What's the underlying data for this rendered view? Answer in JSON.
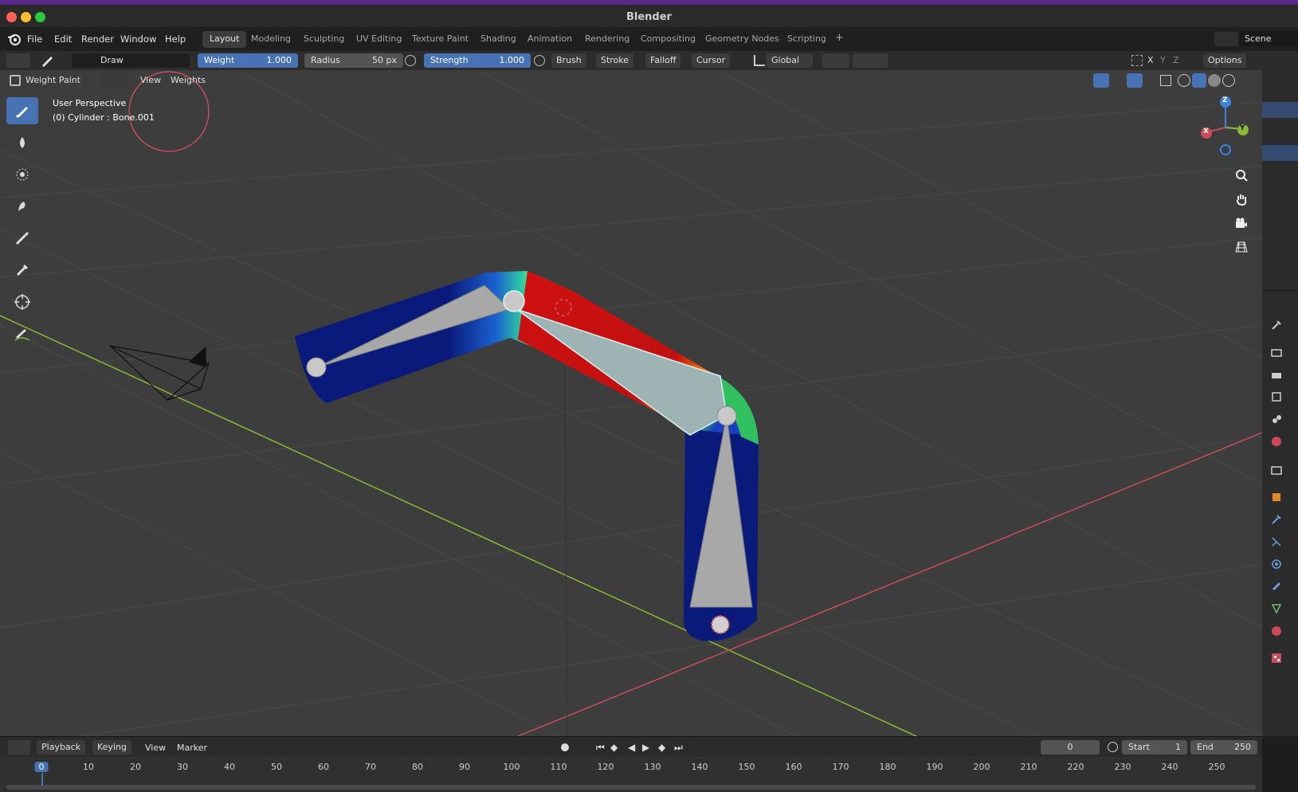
{
  "window": {
    "title": "Blender"
  },
  "menu": [
    "File",
    "Edit",
    "Render",
    "Window",
    "Help"
  ],
  "workspaces": {
    "tabs": [
      "Layout",
      "Modeling",
      "Sculpting",
      "UV Editing",
      "Texture Paint",
      "Shading",
      "Animation",
      "Rendering",
      "Compositing",
      "Geometry Nodes",
      "Scripting"
    ],
    "active": "Layout",
    "add_symbol": "+"
  },
  "scene": {
    "label": "Scene"
  },
  "tool_settings": {
    "brush_name": "Draw",
    "weight": {
      "label": "Weight",
      "value": "1.000"
    },
    "radius": {
      "label": "Radius",
      "value": "50 px"
    },
    "strength": {
      "label": "Strength",
      "value": "1.000"
    },
    "dropdowns": [
      "Brush",
      "Stroke",
      "Falloff",
      "Cursor"
    ],
    "orientation": "Global",
    "axes": [
      "X",
      "Y",
      "Z"
    ],
    "options": "Options"
  },
  "viewport_header": {
    "mode": "Weight Paint",
    "menus": [
      "View",
      "Weights"
    ]
  },
  "viewport": {
    "perspective": "User Perspective",
    "object_info": "(0) Cylinder : Bone.001",
    "gizmo_axes": {
      "x": "X",
      "y": "Y",
      "z": "Z"
    }
  },
  "timeline": {
    "menus": [
      "Playback",
      "Keying",
      "View",
      "Marker"
    ],
    "current_frame": "0",
    "start_label": "Start",
    "start": "1",
    "end_label": "End",
    "end": "250",
    "ticks": [
      "0",
      "10",
      "20",
      "30",
      "40",
      "50",
      "60",
      "70",
      "80",
      "90",
      "100",
      "110",
      "120",
      "130",
      "140",
      "150",
      "160",
      "170",
      "180",
      "190",
      "200",
      "210",
      "220",
      "230",
      "240",
      "250"
    ]
  },
  "colors": {
    "accent": "#4772b3",
    "viewport_bg": "#3d3d3d",
    "axis_x": "#c84b57",
    "axis_y": "#8ab832",
    "axis_z": "#3b83e0"
  },
  "toolbar_icons": [
    "draw-brush-icon",
    "blur-icon",
    "average-icon",
    "smear-icon",
    "gradient-icon",
    "sample-weight-icon",
    "cursor-icon",
    "annotate-icon"
  ],
  "nav_icons": [
    "zoom-icon",
    "pan-hand-icon",
    "camera-view-icon",
    "ortho-grid-icon"
  ],
  "property_icons": [
    "tool-icon",
    "render-icon",
    "output-icon",
    "view-layer-icon",
    "scene-icon",
    "world-icon",
    "collection-icon",
    "object-icon",
    "modifier-icon",
    "particles-icon",
    "physics-icon",
    "constraints-icon",
    "data-icon",
    "material-icon",
    "texture-icon"
  ]
}
